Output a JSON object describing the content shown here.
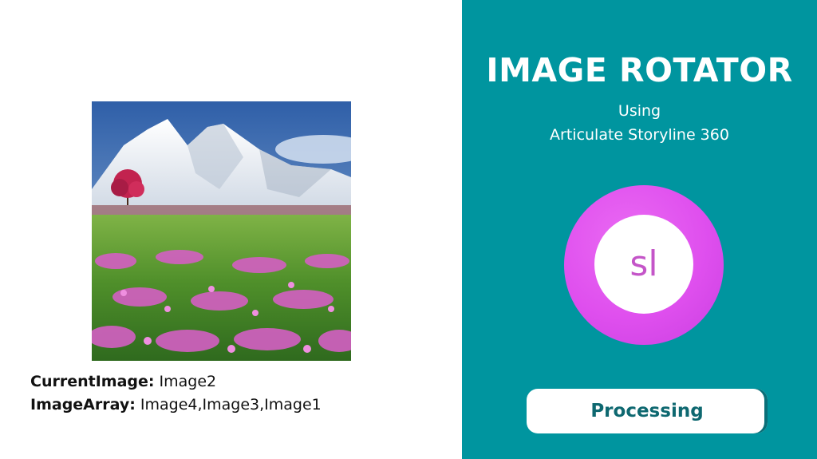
{
  "slide": {
    "title": "IMAGE ROTATOR",
    "subtitle_line1": "Using",
    "subtitle_line2": "Articulate Storyline 360",
    "logo_text": "sl",
    "button_label": "Processing",
    "colors": {
      "panel": "#00959f",
      "logo": "#df4fee",
      "button_text": "#0e6870"
    }
  },
  "image": {
    "icon": "mountain-meadow-photo"
  },
  "variables": [
    {
      "key": "CurrentImage:",
      "value": "Image2"
    },
    {
      "key": "ImageArray:",
      "value": "Image4,Image3,Image1"
    }
  ]
}
